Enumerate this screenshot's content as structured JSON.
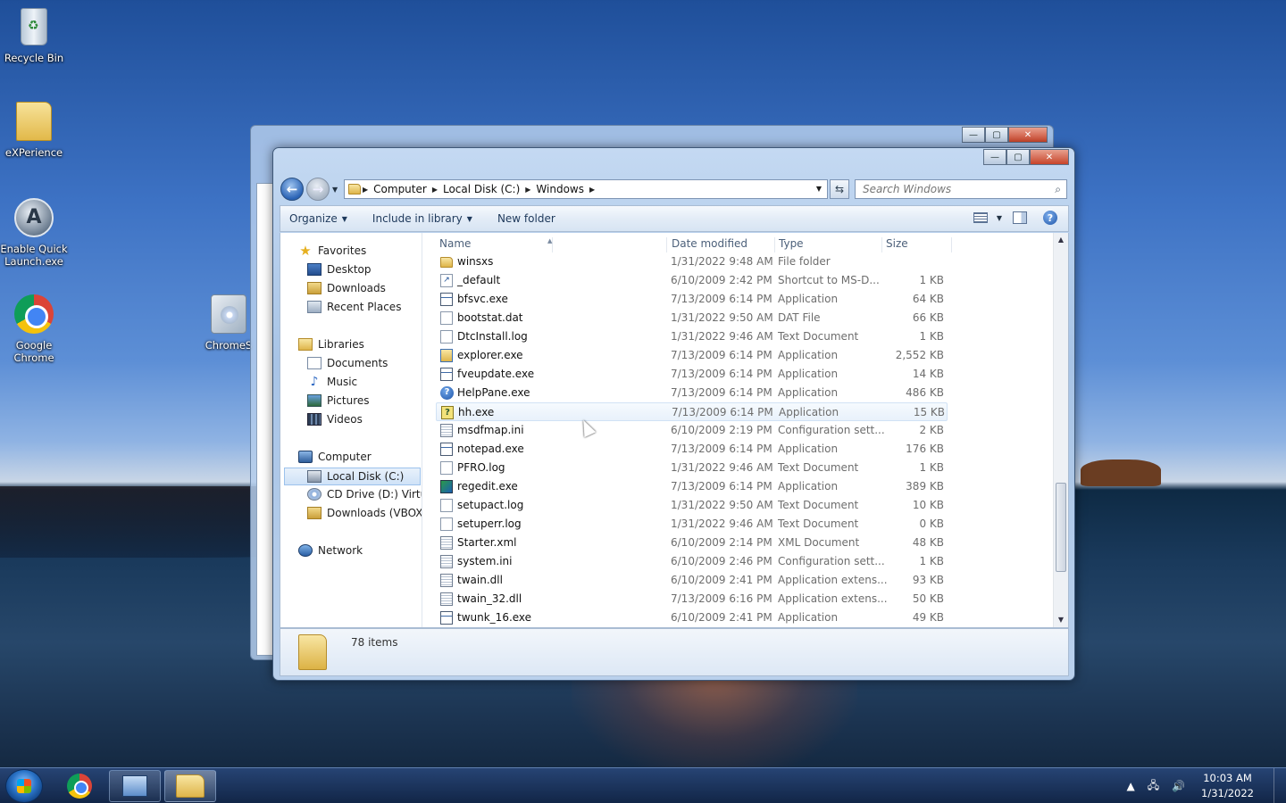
{
  "desktop": {
    "icons": [
      {
        "label": "Recycle Bin"
      },
      {
        "label": "eXPerience"
      },
      {
        "label": "Enable Quick Launch.exe"
      },
      {
        "label": "Google Chrome"
      },
      {
        "label": "ChromeS"
      }
    ]
  },
  "window": {
    "breadcrumbs": [
      "Computer",
      "Local Disk (C:)",
      "Windows"
    ],
    "search_placeholder": "Search Windows",
    "toolbar": {
      "organize": "Organize",
      "include": "Include in library",
      "new_folder": "New folder"
    },
    "nav": {
      "favorites": "Favorites",
      "desktop": "Desktop",
      "downloads": "Downloads",
      "recent": "Recent Places",
      "libraries": "Libraries",
      "documents": "Documents",
      "music": "Music",
      "pictures": "Pictures",
      "videos": "Videos",
      "computer": "Computer",
      "local_disk": "Local Disk (C:)",
      "cd_drive": "CD Drive (D:) Virtual",
      "vbox": "Downloads (VBOXSV",
      "network": "Network"
    },
    "columns": {
      "name": "Name",
      "date": "Date modified",
      "type": "Type",
      "size": "Size"
    },
    "files": [
      {
        "name": "winsxs",
        "date": "1/31/2022 9:48 AM",
        "type": "File folder",
        "size": "",
        "icon": "folder"
      },
      {
        "name": "_default",
        "date": "6/10/2009 2:42 PM",
        "type": "Shortcut to MS-D...",
        "size": "1 KB",
        "icon": "shortcut"
      },
      {
        "name": "bfsvc.exe",
        "date": "7/13/2009 6:14 PM",
        "type": "Application",
        "size": "64 KB",
        "icon": "app"
      },
      {
        "name": "bootstat.dat",
        "date": "1/31/2022 9:50 AM",
        "type": "DAT File",
        "size": "66 KB",
        "icon": "file"
      },
      {
        "name": "DtcInstall.log",
        "date": "1/31/2022 9:46 AM",
        "type": "Text Document",
        "size": "1 KB",
        "icon": "file"
      },
      {
        "name": "explorer.exe",
        "date": "7/13/2009 6:14 PM",
        "type": "Application",
        "size": "2,552 KB",
        "icon": "explorer"
      },
      {
        "name": "fveupdate.exe",
        "date": "7/13/2009 6:14 PM",
        "type": "Application",
        "size": "14 KB",
        "icon": "app"
      },
      {
        "name": "HelpPane.exe",
        "date": "7/13/2009 6:14 PM",
        "type": "Application",
        "size": "486 KB",
        "icon": "help"
      },
      {
        "name": "hh.exe",
        "date": "7/13/2009 6:14 PM",
        "type": "Application",
        "size": "15 KB",
        "icon": "hh"
      },
      {
        "name": "msdfmap.ini",
        "date": "6/10/2009 2:19 PM",
        "type": "Configuration sett...",
        "size": "2 KB",
        "icon": "cfg"
      },
      {
        "name": "notepad.exe",
        "date": "7/13/2009 6:14 PM",
        "type": "Application",
        "size": "176 KB",
        "icon": "app"
      },
      {
        "name": "PFRO.log",
        "date": "1/31/2022 9:46 AM",
        "type": "Text Document",
        "size": "1 KB",
        "icon": "file"
      },
      {
        "name": "regedit.exe",
        "date": "7/13/2009 6:14 PM",
        "type": "Application",
        "size": "389 KB",
        "icon": "reg"
      },
      {
        "name": "setupact.log",
        "date": "1/31/2022 9:50 AM",
        "type": "Text Document",
        "size": "10 KB",
        "icon": "file"
      },
      {
        "name": "setuperr.log",
        "date": "1/31/2022 9:46 AM",
        "type": "Text Document",
        "size": "0 KB",
        "icon": "file"
      },
      {
        "name": "Starter.xml",
        "date": "6/10/2009 2:14 PM",
        "type": "XML Document",
        "size": "48 KB",
        "icon": "cfg"
      },
      {
        "name": "system.ini",
        "date": "6/10/2009 2:46 PM",
        "type": "Configuration sett...",
        "size": "1 KB",
        "icon": "cfg"
      },
      {
        "name": "twain.dll",
        "date": "6/10/2009 2:41 PM",
        "type": "Application extens...",
        "size": "93 KB",
        "icon": "cfg"
      },
      {
        "name": "twain_32.dll",
        "date": "7/13/2009 6:16 PM",
        "type": "Application extens...",
        "size": "50 KB",
        "icon": "cfg"
      },
      {
        "name": "twunk_16.exe",
        "date": "6/10/2009 2:41 PM",
        "type": "Application",
        "size": "49 KB",
        "icon": "app"
      }
    ],
    "item_count": "78 items"
  },
  "taskbar": {
    "time": "10:03 AM",
    "date": "1/31/2022"
  }
}
